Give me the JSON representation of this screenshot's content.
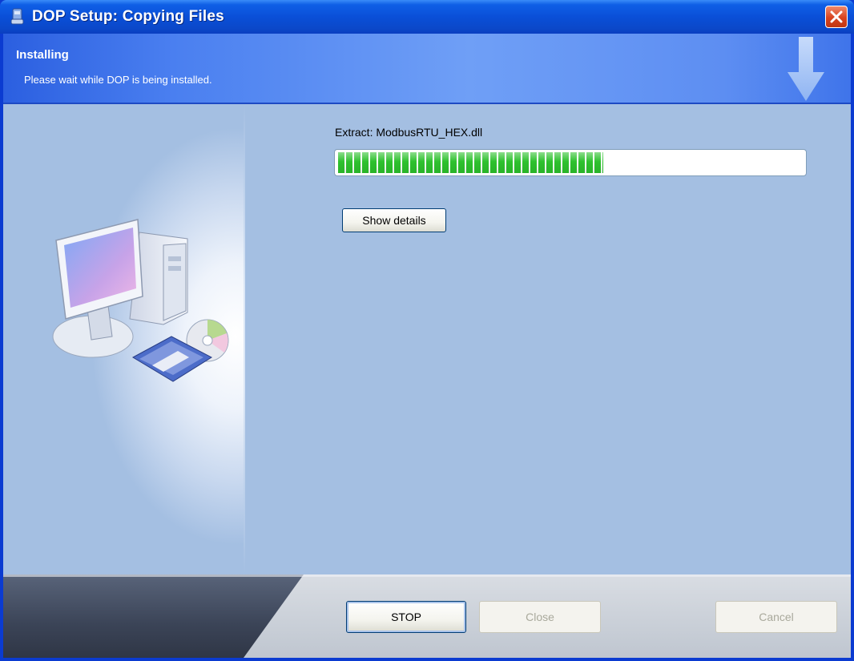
{
  "window": {
    "title": "DOP Setup: Copying Files",
    "close_icon": "close-icon"
  },
  "header": {
    "title": "Installing",
    "subtitle": "Please wait while DOP is being installed."
  },
  "main": {
    "status_text": "Extract: ModbusRTU_HEX.dll",
    "progress_percent": 57,
    "progress_color": "#2ec12e",
    "show_details_label": "Show details"
  },
  "footer": {
    "stop_label": "STOP",
    "close_label": "Close",
    "cancel_label": "Cancel"
  },
  "colors": {
    "title_bar": "#0a4fd8",
    "content_bg": "#a4bfe2",
    "close_button": "#d8431f"
  }
}
